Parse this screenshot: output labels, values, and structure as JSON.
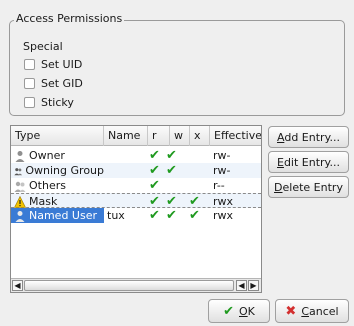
{
  "group": {
    "title": "Access Permissions",
    "special_label": "Special"
  },
  "special": [
    {
      "label": "Set UID",
      "checked": false
    },
    {
      "label": "Set GID",
      "checked": false
    },
    {
      "label": "Sticky",
      "checked": false
    }
  ],
  "table": {
    "headers": [
      "Type",
      "Name",
      "r",
      "w",
      "x",
      "Effective"
    ],
    "rows": [
      {
        "type": "Owner",
        "name": "",
        "r": true,
        "w": true,
        "x": false,
        "effective": "rw-",
        "icon": "user-icon"
      },
      {
        "type": "Owning Group",
        "name": "",
        "r": true,
        "w": true,
        "x": false,
        "effective": "rw-",
        "icon": "group-icon"
      },
      {
        "type": "Others",
        "name": "",
        "r": true,
        "w": false,
        "x": false,
        "effective": "r--",
        "icon": "others-icon"
      },
      {
        "type": "Mask",
        "name": "",
        "r": true,
        "w": true,
        "x": true,
        "effective": "rwx",
        "icon": "warning-icon"
      },
      {
        "type": "Named User",
        "name": "tux",
        "r": true,
        "w": true,
        "x": true,
        "effective": "rwx",
        "icon": "user-icon",
        "selected": true
      }
    ]
  },
  "buttons": {
    "add_prefix": "A",
    "add_rest": "dd Entry...",
    "edit_prefix": "E",
    "edit_rest": "dit Entry...",
    "delete_prefix": "D",
    "delete_rest": "elete Entry",
    "ok_prefix": "O",
    "ok_rest": "K",
    "cancel_prefix": "C",
    "cancel_rest": "ancel"
  },
  "colors": {
    "selection": "#3a7bd5",
    "check": "#1f9a1f",
    "cancel": "#d32f2f"
  }
}
